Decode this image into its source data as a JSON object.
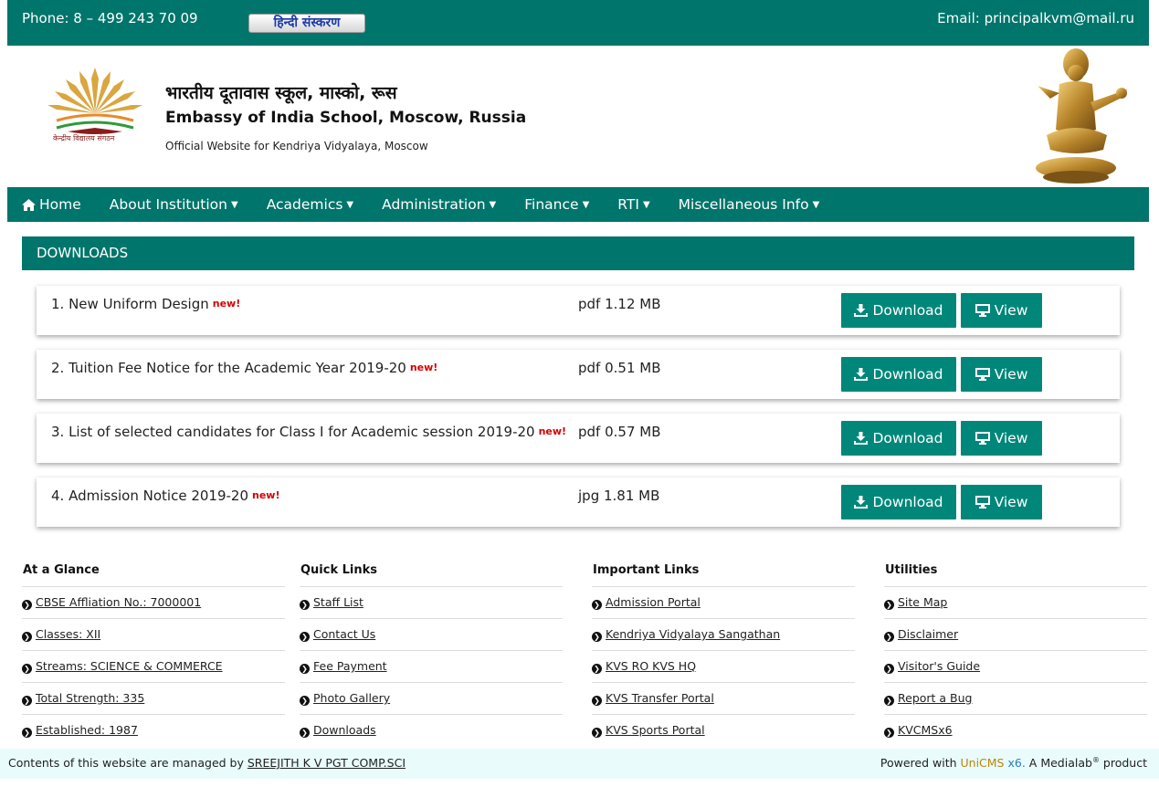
{
  "topbar": {
    "phone": "Phone: 8 – 499 243 70 09",
    "hindi_button": "हिन्दी संस्करण",
    "email": "Email: principalkvm@mail.ru"
  },
  "header": {
    "logo_caption": "केन्द्रीय विद्यालय संगठन",
    "title_hindi": "भारतीय दूतावास स्कूल, मास्को, रूस",
    "title_english": "Embassy of India School, Moscow, Russia",
    "subtitle": "Official Website for Kendriya Vidyalaya, Moscow"
  },
  "nav": {
    "items": [
      "Home",
      "About Institution",
      "Academics",
      "Administration",
      "Finance",
      "RTI",
      "Miscellaneous Info"
    ]
  },
  "downloads": {
    "heading": "DOWNLOADS",
    "new_badge": "new!",
    "download_label": "Download",
    "view_label": "View",
    "items": [
      {
        "name": "1. New Uniform Design",
        "meta": "pdf 1.12 MB"
      },
      {
        "name": "2. Tuition Fee Notice for the Academic Year 2019-20",
        "meta": "pdf 0.51 MB"
      },
      {
        "name": "3. List of selected candidates for Class I for Academic session 2019-20",
        "meta": "pdf 0.57 MB"
      },
      {
        "name": "4. Admission Notice 2019-20",
        "meta": "jpg 1.81 MB"
      }
    ]
  },
  "footer": {
    "columns": [
      {
        "title": "At a Glance",
        "links": [
          "CBSE Affliation No.: 7000001",
          "Classes: XII",
          "Streams: SCIENCE & COMMERCE",
          "Total Strength: 335",
          "Established: 1987"
        ]
      },
      {
        "title": "Quick Links",
        "links": [
          "Staff List",
          "Contact Us",
          "Fee Payment",
          "Photo Gallery",
          "Downloads"
        ]
      },
      {
        "title": "Important Links",
        "links": [
          "Admission Portal",
          "Kendriya Vidyalaya Sangathan",
          "KVS RO KVS HQ",
          "KVS Transfer Portal",
          "KVS Sports Portal"
        ]
      },
      {
        "title": "Utilities",
        "links": [
          "Site Map",
          "Disclaimer",
          "Visitor's Guide",
          "Report a Bug",
          "KVCMSx6"
        ]
      }
    ],
    "managed_prefix": "Contents of this website are managed by",
    "managed_by": "SREEJITH K V PGT COMP.SCI",
    "powered_prefix": "Powered with",
    "powered_uni": "UniCMS",
    "powered_x6": "x6.",
    "powered_suffix": "A Medialab",
    "powered_reg": "®",
    "powered_end": "product"
  }
}
